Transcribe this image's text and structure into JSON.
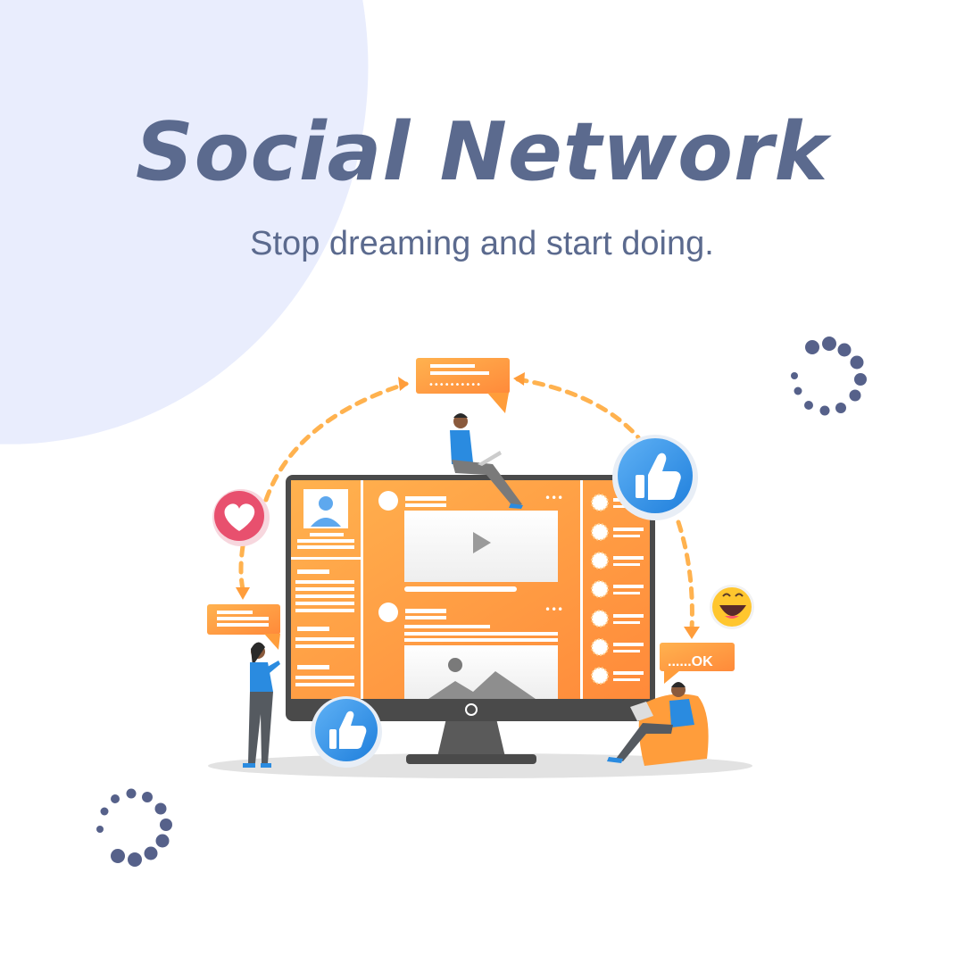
{
  "header": {
    "title": "Social Network",
    "subtitle": "Stop dreaming and start doing."
  },
  "illustration": {
    "ok_bubble_text": "......OK",
    "icons": [
      "heart-icon",
      "thumbs-up-icon",
      "laughing-emoji-icon",
      "play-icon",
      "image-icon",
      "avatar-icon"
    ]
  },
  "colors": {
    "background": "#ffffff",
    "blob": "#e9edfd",
    "title": "#5b6a8e",
    "orange": "#ff9d3b",
    "blue": "#2a8be0",
    "heart_red": "#e8506e",
    "monitor_dark": "#4a4a4a",
    "dots": "#56618a"
  }
}
